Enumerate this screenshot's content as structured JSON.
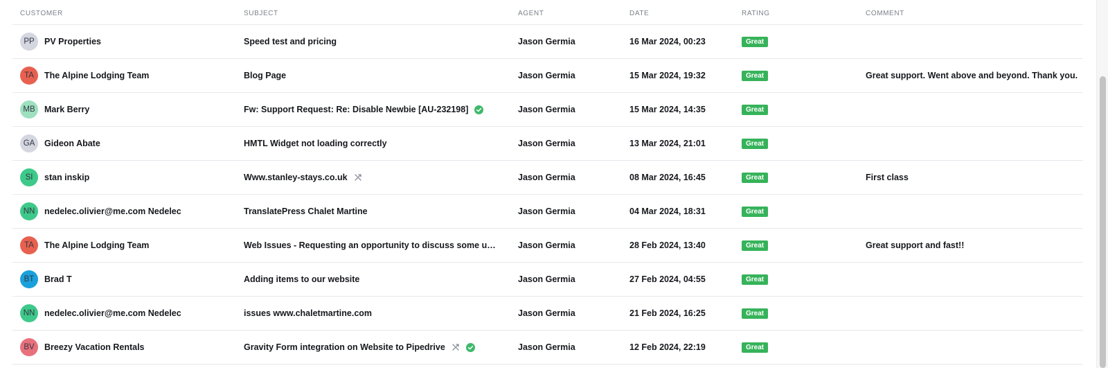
{
  "headers": {
    "customer": "CUSTOMER",
    "subject": "SUBJECT",
    "agent": "AGENT",
    "date": "DATE",
    "rating": "RATING",
    "comment": "COMMENT"
  },
  "rows": [
    {
      "initials": "PP",
      "avatar_color": "#d4d6e0",
      "customer": "PV Properties",
      "subject": "Speed test and pricing",
      "agent": "Jason Germia",
      "date": "16 Mar 2024, 00:23",
      "rating": "Great",
      "comment": "",
      "icons": []
    },
    {
      "initials": "TA",
      "avatar_color": "#e8604f",
      "customer": "The Alpine Lodging Team",
      "subject": "Blog Page",
      "agent": "Jason Germia",
      "date": "15 Mar 2024, 19:32",
      "rating": "Great",
      "comment": "Great support. Went above and beyond. Thank you.",
      "icons": []
    },
    {
      "initials": "MB",
      "avatar_color": "#9ee0c0",
      "customer": "Mark Berry",
      "subject": "Fw: Support Request: Re: Disable Newbie [AU-232198]",
      "agent": "Jason Germia",
      "date": "15 Mar 2024, 14:35",
      "rating": "Great",
      "comment": "",
      "icons": [
        "check-circle-icon"
      ]
    },
    {
      "initials": "GA",
      "avatar_color": "#d4d6e0",
      "customer": "Gideon Abate",
      "subject": "HMTL Widget not loading correctly",
      "agent": "Jason Germia",
      "date": "13 Mar 2024, 21:01",
      "rating": "Great",
      "comment": "",
      "icons": []
    },
    {
      "initials": "SI",
      "avatar_color": "#3ec98a",
      "customer": "stan inskip",
      "subject": "Www.stanley-stays.co.uk",
      "agent": "Jason Germia",
      "date": "08 Mar 2024, 16:45",
      "rating": "Great",
      "comment": "First class",
      "icons": [
        "merge-icon"
      ]
    },
    {
      "initials": "NN",
      "avatar_color": "#3ec98a",
      "customer": "nedelec.olivier@me.com Nedelec",
      "subject": "TranslatePress Chalet Martine",
      "agent": "Jason Germia",
      "date": "04 Mar 2024, 18:31",
      "rating": "Great",
      "comment": "",
      "icons": []
    },
    {
      "initials": "TA",
      "avatar_color": "#e8604f",
      "customer": "The Alpine Lodging Team",
      "subject": "Web Issues - Requesting an opportunity to discuss some up...",
      "agent": "Jason Germia",
      "date": "28 Feb 2024, 13:40",
      "rating": "Great",
      "comment": "Great support and fast!!",
      "icons": []
    },
    {
      "initials": "BT",
      "avatar_color": "#1aa0dc",
      "customer": "Brad T",
      "subject": "Adding items to our website",
      "agent": "Jason Germia",
      "date": "27 Feb 2024, 04:55",
      "rating": "Great",
      "comment": "",
      "icons": []
    },
    {
      "initials": "NN",
      "avatar_color": "#3ec98a",
      "customer": "nedelec.olivier@me.com Nedelec",
      "subject": "issues www.chaletmartine.com",
      "agent": "Jason Germia",
      "date": "21 Feb 2024, 16:25",
      "rating": "Great",
      "comment": "",
      "icons": []
    },
    {
      "initials": "BV",
      "avatar_color": "#e8707c",
      "customer": "Breezy Vacation Rentals",
      "subject": "Gravity Form integration on Website to Pipedrive",
      "agent": "Jason Germia",
      "date": "12 Feb 2024, 22:19",
      "rating": "Great",
      "comment": "",
      "icons": [
        "merge-icon",
        "check-circle-icon"
      ]
    }
  ],
  "colors": {
    "rating_great": "#36b35a",
    "check": "#3fb96a",
    "merge_icon": "#8a8f99"
  }
}
